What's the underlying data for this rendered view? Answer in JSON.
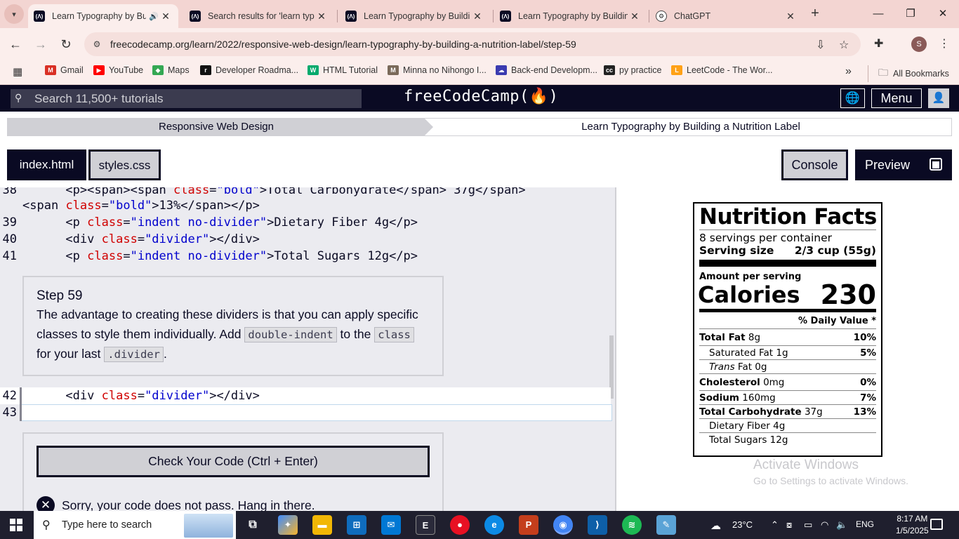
{
  "browser": {
    "tabs": [
      {
        "title": "Learn Typography by Building a Nutrition Label",
        "icon": "fcc-icon",
        "active": true,
        "audio": true
      },
      {
        "title": "Search results for 'learn typography'",
        "icon": "fcc-icon",
        "active": false
      },
      {
        "title": "Learn Typography by Building a Nutrition Label",
        "icon": "fcc-icon",
        "active": false
      },
      {
        "title": "Learn Typography by Building a Nutrition Label",
        "icon": "fcc-icon",
        "active": false
      },
      {
        "title": "ChatGPT",
        "icon": "chatgpt-icon",
        "active": false
      }
    ],
    "url": "freecodecamp.org/learn/2022/responsive-web-design/learn-typography-by-building-a-nutrition-label/step-59",
    "profile_initial": "S",
    "bookmarks": [
      {
        "label": "Gmail",
        "color": "#d93025"
      },
      {
        "label": "YouTube",
        "color": "#ff0000"
      },
      {
        "label": "Maps",
        "color": "#34a853"
      },
      {
        "label": "Developer Roadma...",
        "color": "#111111"
      },
      {
        "label": "HTML Tutorial",
        "color": "#04aa6d"
      },
      {
        "label": "Minna no Nihongo I...",
        "color": "#7a6a5a"
      },
      {
        "label": "Back-end Developm...",
        "color": "#3b3bb0"
      },
      {
        "label": "py practice",
        "color": "#222222"
      },
      {
        "label": "LeetCode - The Wor...",
        "color": "#ffa116"
      }
    ],
    "all_bookmarks": "All Bookmarks"
  },
  "fcc": {
    "search_placeholder": "Search 11,500+ tutorials",
    "logo": "freeCodeCamp(🔥)",
    "menu": "Menu",
    "breadcrumb_course": "Responsive Web Design",
    "breadcrumb_project": "Learn Typography by Building a Nutrition Label",
    "file_tabs": [
      "index.html",
      "styles.css"
    ],
    "console": "Console",
    "preview": "Preview"
  },
  "editor": {
    "lines_top": [
      {
        "num": "38",
        "html": "      <p><span><span class=\"bold\">Total Carbohydrate</span> 37g</span>"
      },
      {
        "num": "",
        "html": "<span class=\"bold\">13%</span></p>"
      },
      {
        "num": "39",
        "html": "      <p class=\"indent no-divider\">Dietary Fiber 4g</p>"
      },
      {
        "num": "40",
        "html": "      <div class=\"divider\"></div>"
      },
      {
        "num": "41",
        "html": "      <p class=\"indent no-divider\">Total Sugars 12g</p>"
      }
    ],
    "line42_num": "42",
    "line42": "      <div class=\"divider\"></div>",
    "line43_num": "43"
  },
  "step": {
    "title": "Step 59",
    "text_1": "The advantage to creating these dividers is that you can apply specific classes to style them individually. Add ",
    "code_1": "double-indent",
    "text_2": " to the ",
    "code_2": "class",
    "text_3": " for your last ",
    "code_3": ".divider",
    "text_4": ".",
    "check_button": "Check Your Code (Ctrl + Enter)",
    "fail_message": "Sorry, your code does not pass. Hang in there."
  },
  "label": {
    "title": "Nutrition Facts",
    "servings": "8 servings per container",
    "serving_size_label": "Serving size",
    "serving_size_value": "2/3 cup (55g)",
    "amount": "Amount per serving",
    "calories_label": "Calories",
    "calories_value": "230",
    "daily_value": "% Daily Value *",
    "rows": [
      {
        "bold": "Total Fat",
        "rest": " 8g",
        "pct": "10%",
        "indent": false,
        "italic": false
      },
      {
        "bold": "",
        "rest": "Saturated Fat 1g",
        "pct": "5%",
        "indent": true,
        "italic": false
      },
      {
        "bold": "",
        "italic_part": "Trans",
        "rest": " Fat 0g",
        "pct": "",
        "indent": true,
        "italic": true
      },
      {
        "bold": "Cholesterol",
        "rest": " 0mg",
        "pct": "0%",
        "indent": false,
        "italic": false
      },
      {
        "bold": "Sodium",
        "rest": " 160mg",
        "pct": "7%",
        "indent": false,
        "italic": false
      },
      {
        "bold": "Total Carbohydrate",
        "rest": " 37g",
        "pct": "13%",
        "indent": false,
        "italic": false
      },
      {
        "bold": "",
        "rest": "Dietary Fiber 4g",
        "pct": "",
        "indent": true,
        "italic": false
      },
      {
        "bold": "",
        "rest": "Total Sugars 12g",
        "pct": "",
        "indent": true,
        "italic": false
      }
    ]
  },
  "watermark": {
    "line1": "Activate Windows",
    "line2": "Go to Settings to activate Windows."
  },
  "taskbar": {
    "search_placeholder": "Type here to search",
    "weather": "23°C",
    "language": "ENG",
    "time": "8:17 AM",
    "date": "1/5/2025"
  }
}
